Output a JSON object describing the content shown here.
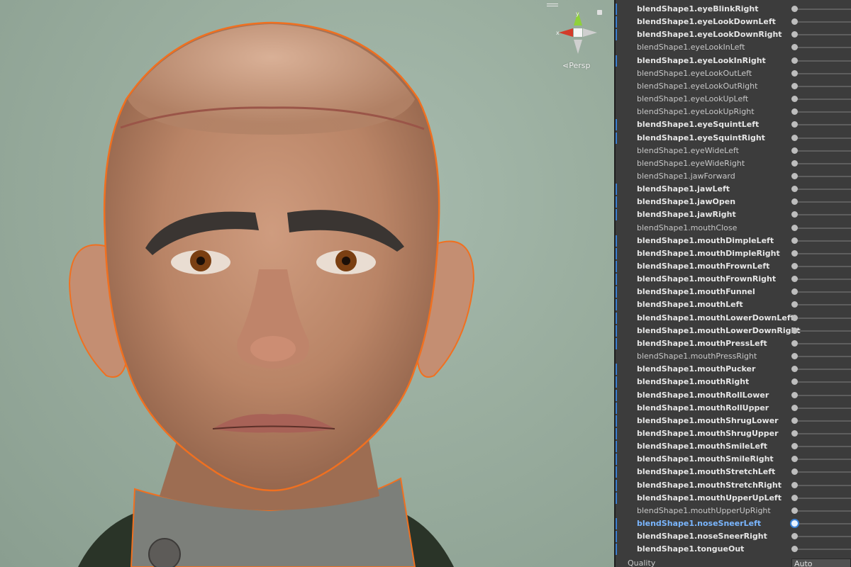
{
  "viewport": {
    "projection_label": "Persp",
    "gizmo": {
      "x_axis": "x",
      "y_axis": "y",
      "x_color": "#d33b2a",
      "y_color": "#8fd13a"
    }
  },
  "blend_shapes": [
    {
      "label": "blendShape1.eyeBlinkRight",
      "bold": true,
      "marked": true
    },
    {
      "label": "blendShape1.eyeLookDownLeft",
      "bold": true,
      "marked": true
    },
    {
      "label": "blendShape1.eyeLookDownRight",
      "bold": true,
      "marked": true
    },
    {
      "label": "blendShape1.eyeLookInLeft",
      "bold": false,
      "marked": false
    },
    {
      "label": "blendShape1.eyeLookInRight",
      "bold": true,
      "marked": true
    },
    {
      "label": "blendShape1.eyeLookOutLeft",
      "bold": false,
      "marked": false
    },
    {
      "label": "blendShape1.eyeLookOutRight",
      "bold": false,
      "marked": false
    },
    {
      "label": "blendShape1.eyeLookUpLeft",
      "bold": false,
      "marked": false
    },
    {
      "label": "blendShape1.eyeLookUpRight",
      "bold": false,
      "marked": false
    },
    {
      "label": "blendShape1.eyeSquintLeft",
      "bold": true,
      "marked": true
    },
    {
      "label": "blendShape1.eyeSquintRight",
      "bold": true,
      "marked": true
    },
    {
      "label": "blendShape1.eyeWideLeft",
      "bold": false,
      "marked": false
    },
    {
      "label": "blendShape1.eyeWideRight",
      "bold": false,
      "marked": false
    },
    {
      "label": "blendShape1.jawForward",
      "bold": false,
      "marked": false
    },
    {
      "label": "blendShape1.jawLeft",
      "bold": true,
      "marked": true
    },
    {
      "label": "blendShape1.jawOpen",
      "bold": true,
      "marked": true
    },
    {
      "label": "blendShape1.jawRight",
      "bold": true,
      "marked": true
    },
    {
      "label": "blendShape1.mouthClose",
      "bold": false,
      "marked": false
    },
    {
      "label": "blendShape1.mouthDimpleLeft",
      "bold": true,
      "marked": true
    },
    {
      "label": "blendShape1.mouthDimpleRight",
      "bold": true,
      "marked": true
    },
    {
      "label": "blendShape1.mouthFrownLeft",
      "bold": true,
      "marked": true
    },
    {
      "label": "blendShape1.mouthFrownRight",
      "bold": true,
      "marked": true
    },
    {
      "label": "blendShape1.mouthFunnel",
      "bold": true,
      "marked": true
    },
    {
      "label": "blendShape1.mouthLeft",
      "bold": true,
      "marked": true
    },
    {
      "label": "blendShape1.mouthLowerDownLeft",
      "bold": true,
      "marked": true
    },
    {
      "label": "blendShape1.mouthLowerDownRight",
      "bold": true,
      "marked": true
    },
    {
      "label": "blendShape1.mouthPressLeft",
      "bold": true,
      "marked": true
    },
    {
      "label": "blendShape1.mouthPressRight",
      "bold": false,
      "marked": false
    },
    {
      "label": "blendShape1.mouthPucker",
      "bold": true,
      "marked": true
    },
    {
      "label": "blendShape1.mouthRight",
      "bold": true,
      "marked": true
    },
    {
      "label": "blendShape1.mouthRollLower",
      "bold": true,
      "marked": true
    },
    {
      "label": "blendShape1.mouthRollUpper",
      "bold": true,
      "marked": true
    },
    {
      "label": "blendShape1.mouthShrugLower",
      "bold": true,
      "marked": true
    },
    {
      "label": "blendShape1.mouthShrugUpper",
      "bold": true,
      "marked": true
    },
    {
      "label": "blendShape1.mouthSmileLeft",
      "bold": true,
      "marked": true
    },
    {
      "label": "blendShape1.mouthSmileRight",
      "bold": true,
      "marked": true
    },
    {
      "label": "blendShape1.mouthStretchLeft",
      "bold": true,
      "marked": true
    },
    {
      "label": "blendShape1.mouthStretchRight",
      "bold": true,
      "marked": true
    },
    {
      "label": "blendShape1.mouthUpperUpLeft",
      "bold": true,
      "marked": true
    },
    {
      "label": "blendShape1.mouthUpperUpRight",
      "bold": false,
      "marked": false
    },
    {
      "label": "blendShape1.noseSneerLeft",
      "bold": true,
      "marked": true,
      "selected": true
    },
    {
      "label": "blendShape1.noseSneerRight",
      "bold": true,
      "marked": true
    },
    {
      "label": "blendShape1.tongueOut",
      "bold": true,
      "marked": true
    }
  ],
  "quality": {
    "label": "Quality",
    "value": "Auto"
  },
  "colors": {
    "selection_outline": "#f07020",
    "selected_text": "#7ab6ff",
    "row_marker": "#3b7fd0"
  }
}
